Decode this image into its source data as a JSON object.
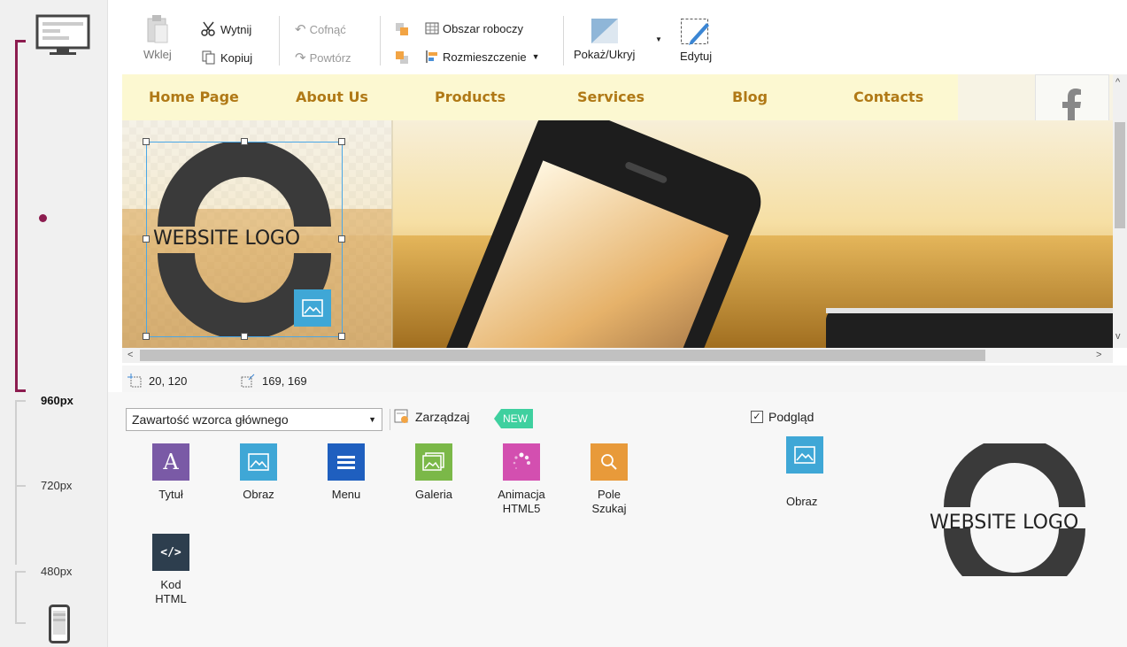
{
  "device_rail": {
    "sizes": [
      "960px",
      "720px",
      "480px"
    ],
    "monitor_icon": "desktop-monitor-icon",
    "phone_icon": "mobile-phone-icon",
    "accent": "#8c1c4f"
  },
  "toolbar": {
    "paste_label": "Wklej",
    "cut_label": "Wytnij",
    "copy_label": "Kopiuj",
    "undo_label": "Cofnąć",
    "redo_label": "Powtórz",
    "workspace_label": "Obszar roboczy",
    "layout_label": "Rozmieszczenie",
    "showhide_label": "Pokaż/Ukryj",
    "edit_label": "Edytuj"
  },
  "canvas": {
    "nav": [
      "Home Page",
      "About Us",
      "Products",
      "Services",
      "Blog",
      "Contacts"
    ],
    "nav_color": "#b07916",
    "nav_bg": "#fcf8d1",
    "logo_text": "WEBSITE LOGO",
    "social_icon": "facebook-icon"
  },
  "status": {
    "position": "20, 120",
    "size": "169, 169"
  },
  "panel": {
    "template_select": "Zawartość wzorca głównego",
    "manage_label": "Zarządzaj",
    "new_badge": "NEW",
    "preview_label": "Podgląd",
    "preview_checked": true,
    "preview_item_label": "Obraz",
    "preview_logo_text": "WEBSITE LOGO",
    "widgets": [
      {
        "label": "Tytuł",
        "color": "#7a5aa6",
        "icon": "title-icon"
      },
      {
        "label": "Obraz",
        "color": "#3fa7d6",
        "icon": "image-icon"
      },
      {
        "label": "Menu",
        "color": "#1f5fbf",
        "icon": "menu-icon"
      },
      {
        "label": "Galeria",
        "color": "#7bb848",
        "icon": "gallery-icon"
      },
      {
        "label": "Animacja HTML5",
        "color": "#d34fb0",
        "icon": "animation-icon"
      },
      {
        "label": "Pole Szukaj",
        "color": "#e89a3a",
        "icon": "search-icon"
      },
      {
        "label": "Kod HTML",
        "color": "#2d3e4e",
        "icon": "code-icon"
      }
    ]
  }
}
